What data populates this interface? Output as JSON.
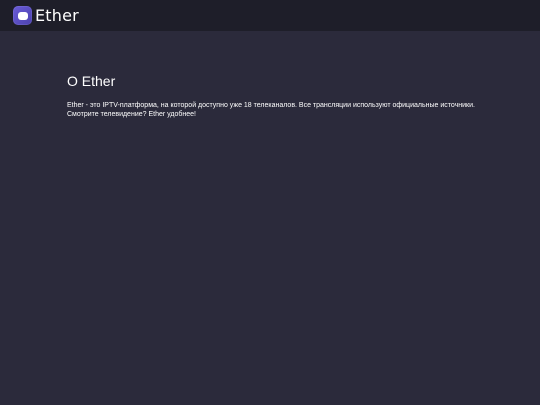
{
  "header": {
    "logo_text": "Ether",
    "logo_icon": "tv-screen-icon",
    "background": "#1e1e29"
  },
  "main": {
    "title": "О Ether",
    "description_line1": "Ether - это IPTV-платформа, на которой доступно уже 18 телеканалов. Все трансляции используют официальные источники.",
    "description_line2": "Смотрите телевидение? Ether удобнее!",
    "background": "#2b2a3b"
  },
  "colors": {
    "accent": "#5b4fc7",
    "text": "#ffffff"
  }
}
